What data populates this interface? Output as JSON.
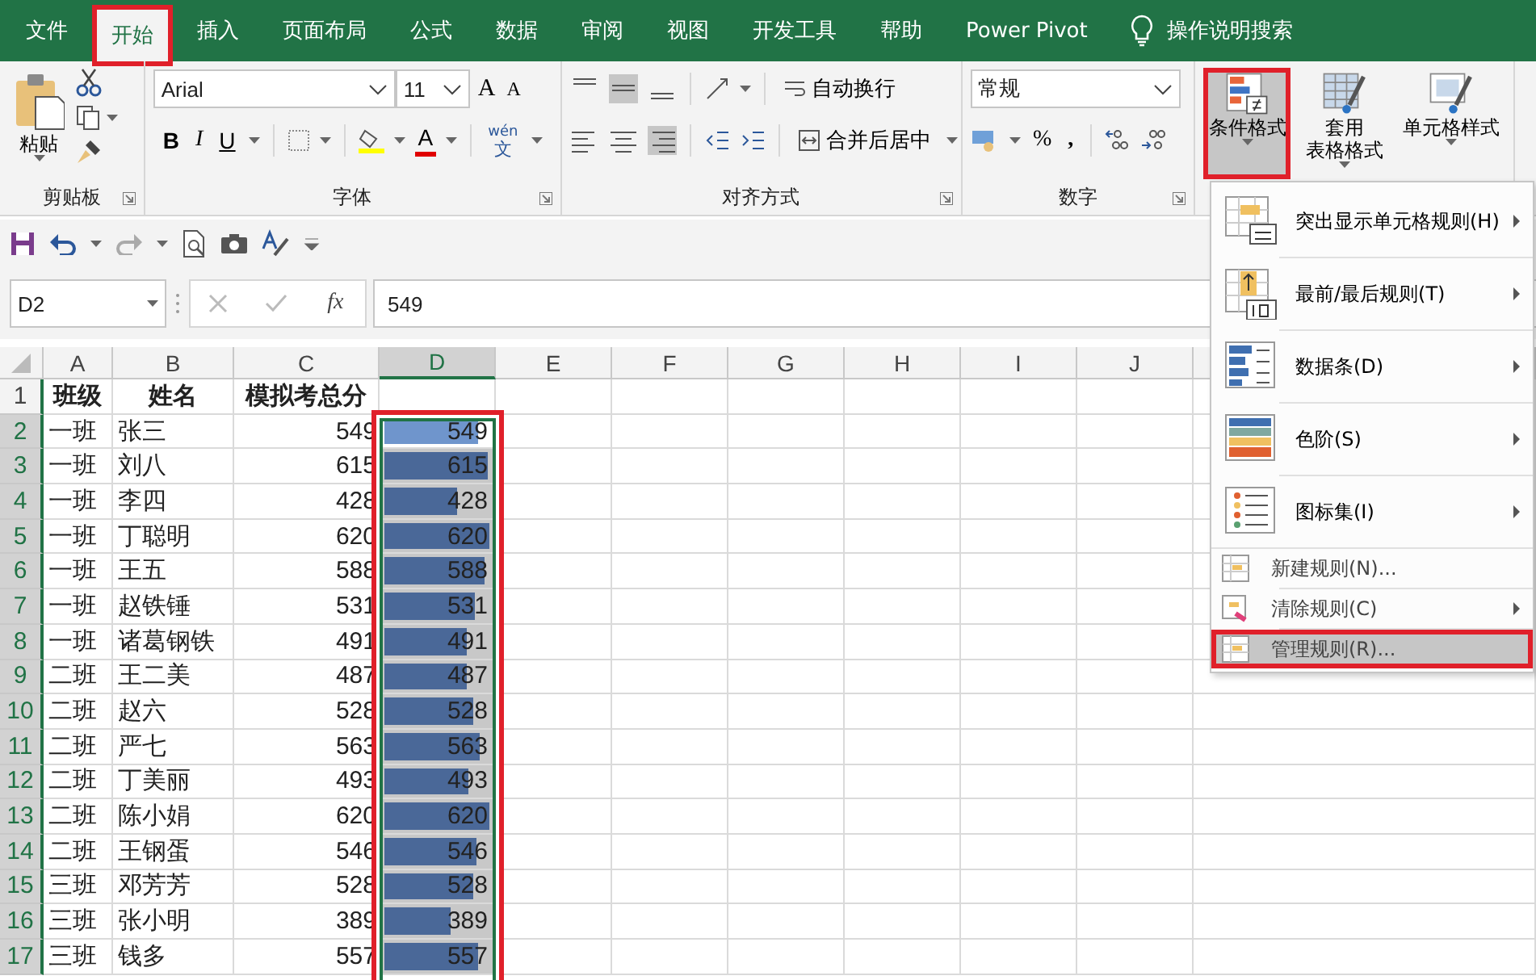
{
  "ribbon_tabs": [
    {
      "label": "文件",
      "selected": false,
      "highlighted": false
    },
    {
      "label": "开始",
      "selected": true,
      "highlighted": true
    },
    {
      "label": "插入",
      "selected": false,
      "highlighted": false
    },
    {
      "label": "页面布局",
      "selected": false,
      "highlighted": false
    },
    {
      "label": "公式",
      "selected": false,
      "highlighted": false
    },
    {
      "label": "数据",
      "selected": false,
      "highlighted": false
    },
    {
      "label": "审阅",
      "selected": false,
      "highlighted": false
    },
    {
      "label": "视图",
      "selected": false,
      "highlighted": false
    },
    {
      "label": "开发工具",
      "selected": false,
      "highlighted": false
    },
    {
      "label": "帮助",
      "selected": false,
      "highlighted": false
    },
    {
      "label": "Power Pivot",
      "selected": false,
      "highlighted": false
    }
  ],
  "tell_me": {
    "label": "操作说明搜索"
  },
  "clipboard": {
    "paste": "粘贴",
    "group": "剪贴板"
  },
  "font": {
    "name": "Arial",
    "size": "11",
    "grow": "A",
    "shrink": "A",
    "bold": "B",
    "italic": "I",
    "underline": "U",
    "color_letter": "A",
    "phonetic_top": "wén",
    "phonetic_bottom": "文",
    "group": "字体"
  },
  "alignment": {
    "wrap": "自动换行",
    "merge": "合并后居中",
    "group": "对齐方式"
  },
  "number": {
    "format": "常规",
    "percent": "%",
    "comma": ",",
    "group": "数字"
  },
  "styles": [
    {
      "lines": [
        "条件格式"
      ],
      "highlighted": true,
      "selected": true
    },
    {
      "lines": [
        "套用",
        "表格格式"
      ],
      "highlighted": false,
      "selected": false
    },
    {
      "lines": [
        "单元格样式"
      ],
      "highlighted": false,
      "selected": false
    }
  ],
  "name_box": "D2",
  "fx": "fx",
  "formula": "549",
  "columns": [
    {
      "label": "A",
      "selected": false,
      "highlighted": false
    },
    {
      "label": "B",
      "selected": false,
      "highlighted": false
    },
    {
      "label": "C",
      "selected": false,
      "highlighted": false
    },
    {
      "label": "D",
      "selected": true,
      "highlighted": true
    },
    {
      "label": "E",
      "selected": false,
      "highlighted": false
    },
    {
      "label": "F",
      "selected": false,
      "highlighted": false
    },
    {
      "label": "G",
      "selected": false,
      "highlighted": false
    },
    {
      "label": "H",
      "selected": false,
      "highlighted": false
    },
    {
      "label": "I",
      "selected": false,
      "highlighted": false
    },
    {
      "label": "J",
      "selected": false,
      "highlighted": false
    }
  ],
  "header_row": {
    "number": "1",
    "selected": false,
    "cells": [
      "班级",
      "姓名",
      "模拟考总分"
    ]
  },
  "rows": [
    {
      "number": "2",
      "selected": true,
      "class": "一班",
      "name": "张三",
      "score": "549",
      "bar": {
        "value": "549",
        "level": 0.885,
        "active": true
      }
    },
    {
      "number": "3",
      "selected": true,
      "class": "一班",
      "name": "刘八",
      "score": "615",
      "bar": {
        "value": "615",
        "level": 0.992,
        "active": false
      }
    },
    {
      "number": "4",
      "selected": true,
      "class": "一班",
      "name": "李四",
      "score": "428",
      "bar": {
        "value": "428",
        "level": 0.69,
        "active": false
      }
    },
    {
      "number": "5",
      "selected": true,
      "class": "一班",
      "name": "丁聪明",
      "score": "620",
      "bar": {
        "value": "620",
        "level": 1,
        "active": false
      }
    },
    {
      "number": "6",
      "selected": true,
      "class": "一班",
      "name": "王五",
      "score": "588",
      "bar": {
        "value": "588",
        "level": 0.948,
        "active": false
      }
    },
    {
      "number": "7",
      "selected": true,
      "class": "一班",
      "name": "赵铁锤",
      "score": "531",
      "bar": {
        "value": "531",
        "level": 0.856,
        "active": false
      }
    },
    {
      "number": "8",
      "selected": true,
      "class": "一班",
      "name": "诸葛钢铁",
      "score": "491",
      "bar": {
        "value": "491",
        "level": 0.792,
        "active": false
      }
    },
    {
      "number": "9",
      "selected": true,
      "class": "二班",
      "name": "王二美",
      "score": "487",
      "bar": {
        "value": "487",
        "level": 0.785,
        "active": false
      }
    },
    {
      "number": "10",
      "selected": true,
      "class": "二班",
      "name": "赵六",
      "score": "528",
      "bar": {
        "value": "528",
        "level": 0.852,
        "active": false
      }
    },
    {
      "number": "11",
      "selected": true,
      "class": "二班",
      "name": "严七",
      "score": "563",
      "bar": {
        "value": "563",
        "level": 0.908,
        "active": false
      }
    },
    {
      "number": "12",
      "selected": true,
      "class": "二班",
      "name": "丁美丽",
      "score": "493",
      "bar": {
        "value": "493",
        "level": 0.795,
        "active": false
      }
    },
    {
      "number": "13",
      "selected": true,
      "class": "二班",
      "name": "陈小娟",
      "score": "620",
      "bar": {
        "value": "620",
        "level": 1,
        "active": false
      }
    },
    {
      "number": "14",
      "selected": true,
      "class": "二班",
      "name": "王钢蛋",
      "score": "546",
      "bar": {
        "value": "546",
        "level": 0.881,
        "active": false
      }
    },
    {
      "number": "15",
      "selected": true,
      "class": "三班",
      "name": "邓芳芳",
      "score": "528",
      "bar": {
        "value": "528",
        "level": 0.852,
        "active": false
      }
    },
    {
      "number": "16",
      "selected": true,
      "class": "三班",
      "name": "张小明",
      "score": "389",
      "bar": {
        "value": "389",
        "level": 0.627,
        "active": false
      }
    },
    {
      "number": "17",
      "selected": true,
      "class": "三班",
      "name": "钱多",
      "score": "557",
      "bar": {
        "value": "557",
        "level": 0.898,
        "active": false
      }
    }
  ],
  "menu": {
    "items": [
      {
        "kind": "large",
        "label": "突出显示单元格规则(H)",
        "submenu": true,
        "selected": false,
        "highlighted": false
      },
      {
        "kind": "large",
        "label": "最前/最后规则(T)",
        "submenu": true,
        "selected": false,
        "highlighted": false
      },
      {
        "kind": "large",
        "label": "数据条(D)",
        "submenu": true,
        "selected": false,
        "highlighted": false
      },
      {
        "kind": "large",
        "label": "色阶(S)",
        "submenu": true,
        "selected": false,
        "highlighted": false
      },
      {
        "kind": "large",
        "label": "图标集(I)",
        "submenu": true,
        "selected": false,
        "highlighted": false
      },
      {
        "kind": "small",
        "label": "新建规则(N)...",
        "submenu": false,
        "selected": false,
        "highlighted": false
      },
      {
        "kind": "small",
        "label": "清除规则(C)",
        "submenu": true,
        "selected": false,
        "highlighted": false
      },
      {
        "kind": "small",
        "label": "管理规则(R)...",
        "submenu": false,
        "selected": true,
        "highlighted": true
      }
    ]
  }
}
